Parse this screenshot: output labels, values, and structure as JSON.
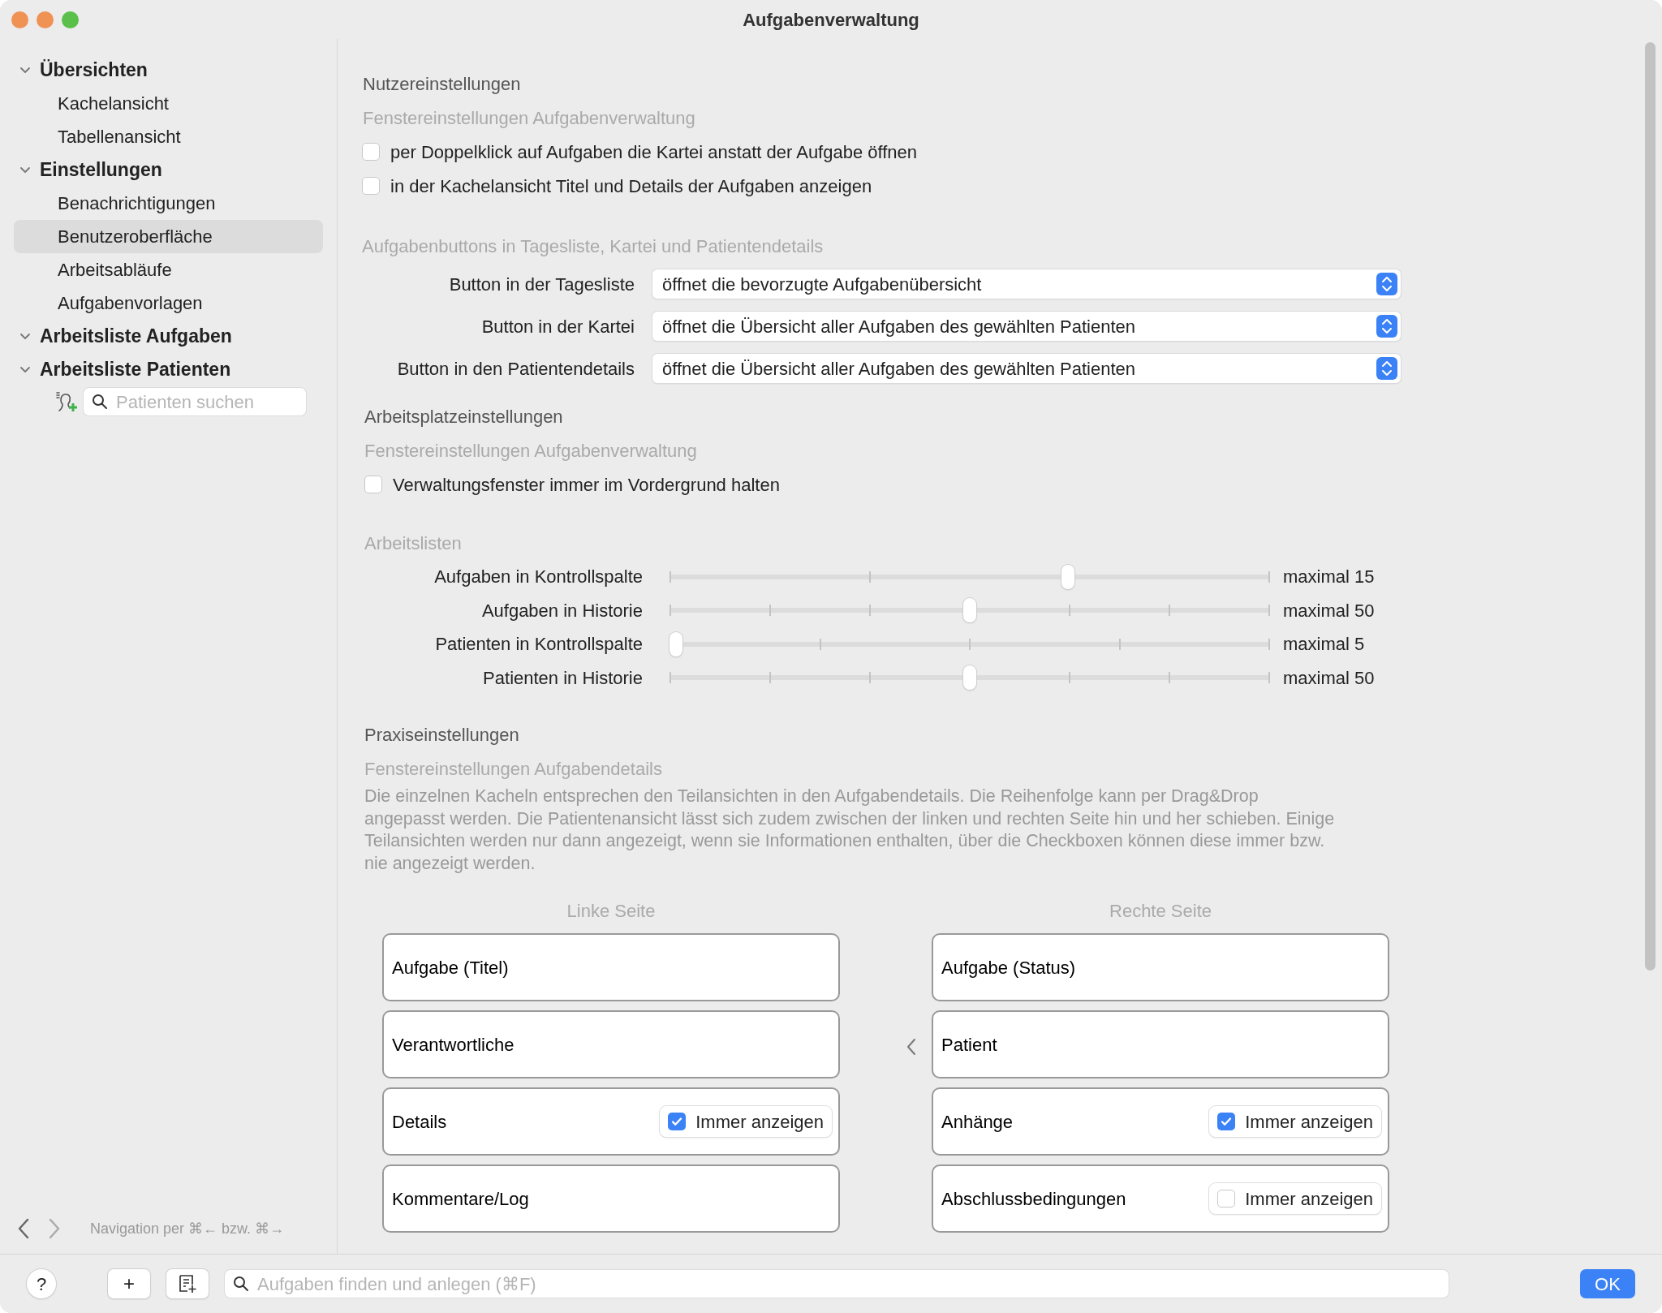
{
  "window": {
    "title": "Aufgabenverwaltung"
  },
  "sidebar": {
    "groups": [
      {
        "label": "Übersichten",
        "expanded": true,
        "children": [
          {
            "label": "Kachelansicht",
            "selected": false
          },
          {
            "label": "Tabellenansicht",
            "selected": false
          }
        ]
      },
      {
        "label": "Einstellungen",
        "expanded": true,
        "children": [
          {
            "label": "Benachrichtigungen",
            "selected": false
          },
          {
            "label": "Benutzeroberfläche",
            "selected": true
          },
          {
            "label": "Arbeitsabläufe",
            "selected": false
          },
          {
            "label": "Aufgabenvorlagen",
            "selected": false
          }
        ]
      },
      {
        "label": "Arbeitsliste Aufgaben",
        "expanded": true
      },
      {
        "label": "Arbeitsliste Patienten",
        "expanded": true
      }
    ],
    "patient_search": {
      "placeholder": "Patienten suchen"
    },
    "navigation_hint": "Navigation per ⌘← bzw. ⌘→"
  },
  "user_settings": {
    "title": "Nutzereinstellungen",
    "subtitle": "Fenstereinstellungen Aufgabenverwaltung",
    "options": [
      {
        "label": "per Doppelklick auf Aufgaben die Kartei anstatt der Aufgabe öffnen",
        "checked": false
      },
      {
        "label": "in der Kachelansicht Titel und Details der Aufgaben anzeigen",
        "checked": false
      }
    ],
    "buttons_title": "Aufgabenbuttons in Tagesliste, Kartei und Patientendetails",
    "dropdowns": [
      {
        "label": "Button in der Tagesliste",
        "value": "öffnet die bevorzugte Aufgabenübersicht"
      },
      {
        "label": "Button in der Kartei",
        "value": "öffnet die Übersicht aller Aufgaben des gewählten Patienten"
      },
      {
        "label": "Button in den Patientendetails",
        "value": "öffnet die Übersicht aller Aufgaben des gewählten Patienten"
      }
    ]
  },
  "workstation_settings": {
    "title": "Arbeitsplatzeinstellungen",
    "subtitle": "Fenstereinstellungen Aufgabenverwaltung",
    "options": [
      {
        "label": "Verwaltungsfenster immer im Vordergrund halten",
        "checked": false
      }
    ],
    "worklists_title": "Arbeitslisten",
    "sliders": [
      {
        "label": "Aufgaben in Kontrollspalte",
        "level": 0.667,
        "reading": "maximal 15"
      },
      {
        "label": "Aufgaben in Historie",
        "level": 0.5,
        "reading": "maximal 50"
      },
      {
        "label": "Patienten in Kontrollspalte",
        "level": 0,
        "reading": "maximal 5"
      },
      {
        "label": "Patienten in Historie",
        "level": 0.5,
        "reading": "maximal 50"
      }
    ]
  },
  "practice_settings": {
    "title": "Praxiseinstellungen",
    "subtitle": "Fenstereinstellungen Aufgabendetails",
    "description": "Die einzelnen Kacheln entsprechen den Teilansichten in den Aufgabendetails. Die Reihenfolge kann per Drag&Drop angepasst werden. Die Patientenansicht lässt sich zudem zwischen der linken und rechten Seite hin und her schieben. Einige Teilansichten werden nur dann angezeigt, wenn sie Informationen enthalten, über die Checkboxen können diese immer bzw. nie angezeigt werden.",
    "columns": [
      {
        "title": "Linke Seite",
        "tiles": [
          {
            "label": "Aufgabe (Titel)",
            "kind": "plain"
          },
          {
            "label": "Verantwortliche",
            "kind": "plain"
          },
          {
            "label": "Details",
            "kind": "toggle",
            "checked": true,
            "toggle_label": "Immer anzeigen"
          },
          {
            "label": "Kommentare/Log",
            "kind": "plain"
          }
        ]
      },
      {
        "title": "Rechte Seite",
        "tiles": [
          {
            "label": "Aufgabe (Status)",
            "kind": "plain"
          },
          {
            "label": "Patient",
            "kind": "movable"
          },
          {
            "label": "Anhänge",
            "kind": "toggle",
            "checked": true,
            "toggle_label": "Immer anzeigen"
          },
          {
            "label": "Abschlussbedingungen",
            "kind": "toggle",
            "checked": false,
            "toggle_label": "Immer anzeigen"
          }
        ]
      }
    ]
  },
  "bottom_bar": {
    "help": "?",
    "add": "+",
    "search_placeholder": "Aufgaben finden und anlegen (⌘F)",
    "ok": "OK"
  }
}
